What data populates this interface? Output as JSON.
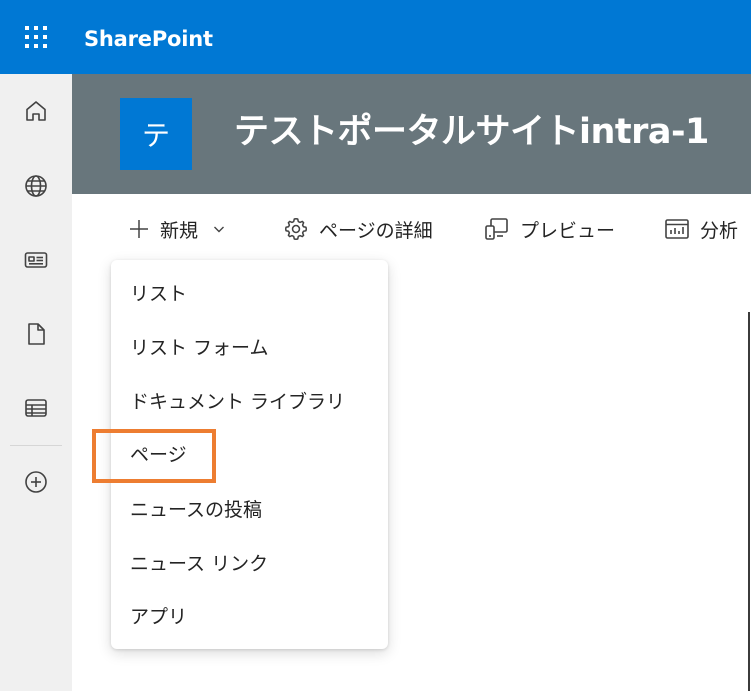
{
  "suite_bar": {
    "app_name": "SharePoint",
    "color": "#0078d4",
    "waffle_icon": "app-launcher-icon"
  },
  "app_bar": {
    "items": [
      {
        "icon": "home-icon"
      },
      {
        "icon": "globe-icon"
      },
      {
        "icon": "news-icon"
      },
      {
        "icon": "document-icon"
      },
      {
        "icon": "lists-icon"
      },
      {
        "icon": "add-circle-icon"
      }
    ]
  },
  "site_header": {
    "logo_letter": "テ",
    "title": "テストポータルサイトintra-1",
    "background": "#68767c"
  },
  "command_bar": {
    "new_label": "新規",
    "page_details_label": "ページの詳細",
    "preview_label": "プレビュー",
    "analytics_label": "分析"
  },
  "new_menu": {
    "items": [
      {
        "label": "リスト"
      },
      {
        "label": "リスト フォーム"
      },
      {
        "label": "ドキュメント ライブラリ"
      },
      {
        "label": "ページ"
      },
      {
        "label": "ニュースの投稿"
      },
      {
        "label": "ニュース リンク"
      },
      {
        "label": "アプリ"
      }
    ],
    "highlighted_label": "ページ",
    "highlight_color": "#ed7d31"
  }
}
